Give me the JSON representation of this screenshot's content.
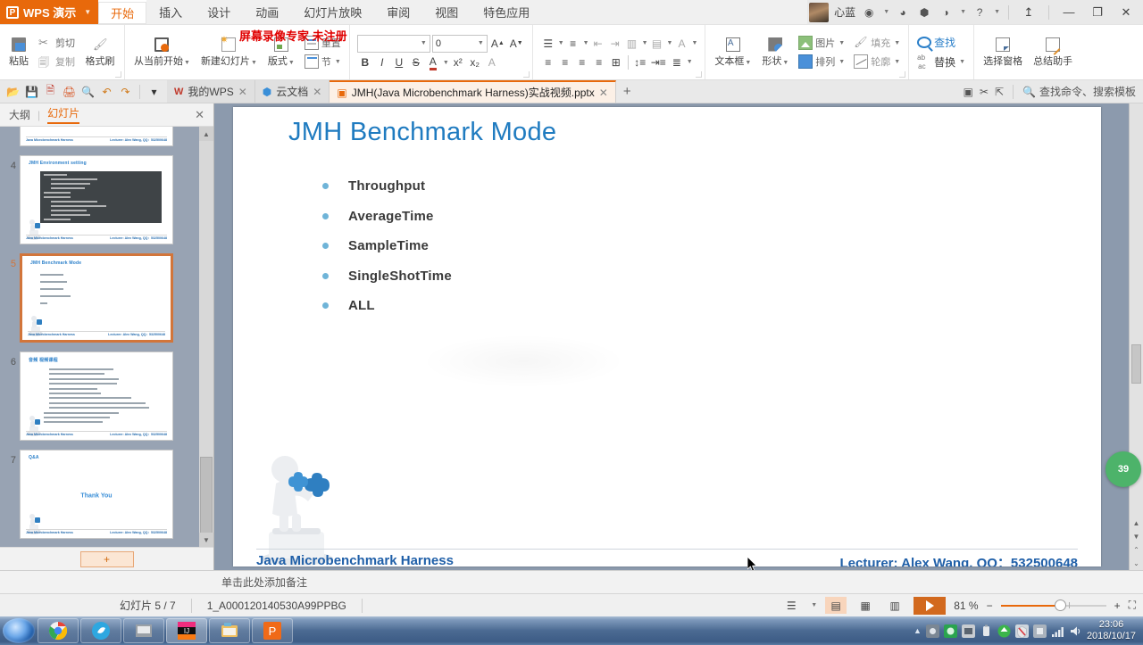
{
  "window": {
    "app_name": "WPS 演示",
    "user_name": "心蓝",
    "menu": [
      "开始",
      "插入",
      "设计",
      "动画",
      "幻灯片放映",
      "审阅",
      "视图",
      "特色应用"
    ],
    "active_menu": "开始",
    "minimize_label": "—",
    "maximize_label": "❐",
    "close_label": "✕",
    "share_label": "↥",
    "help_label": "?"
  },
  "watermark": "屏幕录像专家  未注册",
  "ribbon": {
    "clipboard": {
      "paste": "粘贴",
      "cut": "剪切",
      "copy": "复制",
      "format_painter": "格式刷"
    },
    "slides": {
      "start_from_current": "从当前开始",
      "new_slide": "新建幻灯片",
      "layout": "版式",
      "section": "节",
      "reset": "重置"
    },
    "font": {
      "font_name": "",
      "font_size": "0",
      "grow": "A",
      "shrink": "A",
      "bold": "B",
      "italic": "I",
      "underline": "U",
      "strike": "S",
      "text_color": "A",
      "superscript": "x²",
      "subscript": "x₂",
      "clear_format": "A"
    },
    "drawing": {
      "textbox": "文本框",
      "shapes": "形状",
      "picture": "图片",
      "arrange": "排列",
      "fill": "填充",
      "outline": "轮廓"
    },
    "editing": {
      "find": "查找",
      "replace": "替换",
      "select_pane": "选择窗格",
      "summary_helper": "总结助手"
    }
  },
  "tabstrip": {
    "tabs": [
      {
        "label": "我的WPS",
        "icon": "wps-icon",
        "active": false
      },
      {
        "label": "云文档",
        "icon": "cloud-icon",
        "active": false
      },
      {
        "label": "JMH(Java Microbenchmark Harness)实战视频.pptx",
        "icon": "ppt-icon",
        "active": true
      }
    ],
    "new_tab": "+",
    "search_placeholder": "查找命令、搜索模板"
  },
  "thumbnail_pane": {
    "tab_outline": "大纲",
    "tab_slides": "幻灯片",
    "active_tab": "幻灯片",
    "close": "✕",
    "add_slide": "+",
    "slides": [
      {
        "number": "4",
        "title": "JMH Environment setting",
        "type": "code",
        "selected": false,
        "footer_left": "Java Microbenchmark Harness",
        "footer_right": "Lecturer: Alex Wang, QQ：532500648"
      },
      {
        "number": "5",
        "title": "JMH Benchmark Mode",
        "type": "bullets",
        "selected": true,
        "footer_left": "Java Microbenchmark Harness",
        "footer_right": "Lecturer: Alex Wang, QQ：532500648"
      },
      {
        "number": "6",
        "title": "音频 视频课程",
        "type": "list",
        "selected": false,
        "footer_left": "Java Microbenchmark Harness",
        "footer_right": "Lecturer: Alex Wang, QQ：532500648"
      },
      {
        "number": "7",
        "title": "Q&A",
        "type": "thanks",
        "selected": false,
        "thanks": "Thank You",
        "footer_left": "Java Microbenchmark Harness",
        "footer_right": "Lecturer: Alex Wang, QQ：532500648"
      }
    ]
  },
  "slide": {
    "title": "JMH Benchmark Mode",
    "bullets": [
      "Throughput",
      "AverageTime",
      "SampleTime",
      "SingleShotTime",
      "ALL"
    ],
    "footer_left": "Java Microbenchmark Harness",
    "footer_right": "Lecturer: Alex Wang, QQ：532500648",
    "accent_color": "#1F7BC0",
    "bullet_color": "#6fb4d8"
  },
  "notes": {
    "placeholder": "单击此处添加备注"
  },
  "statusbar": {
    "slide_counter": "幻灯片 5 / 7",
    "template_id": "1_A000120140530A99PPBG",
    "zoom_value": "81 %",
    "zoom_out": "−",
    "zoom_in": "+",
    "fit_label": "⛶",
    "view_normal": "normal-view-icon",
    "view_sorter": "slide-sorter-icon",
    "view_reading": "reading-view-icon",
    "play": "play-slideshow-icon"
  },
  "float_badge": "39",
  "taskbar": {
    "start": "start-orb",
    "items": [
      "chrome-icon",
      "qq-browser-icon",
      "explorer-icon",
      "intellij-idea-icon",
      "file-manager-icon",
      "wps-presentation-icon"
    ],
    "clock_time": "23:06",
    "clock_date": "2018/10/17"
  }
}
